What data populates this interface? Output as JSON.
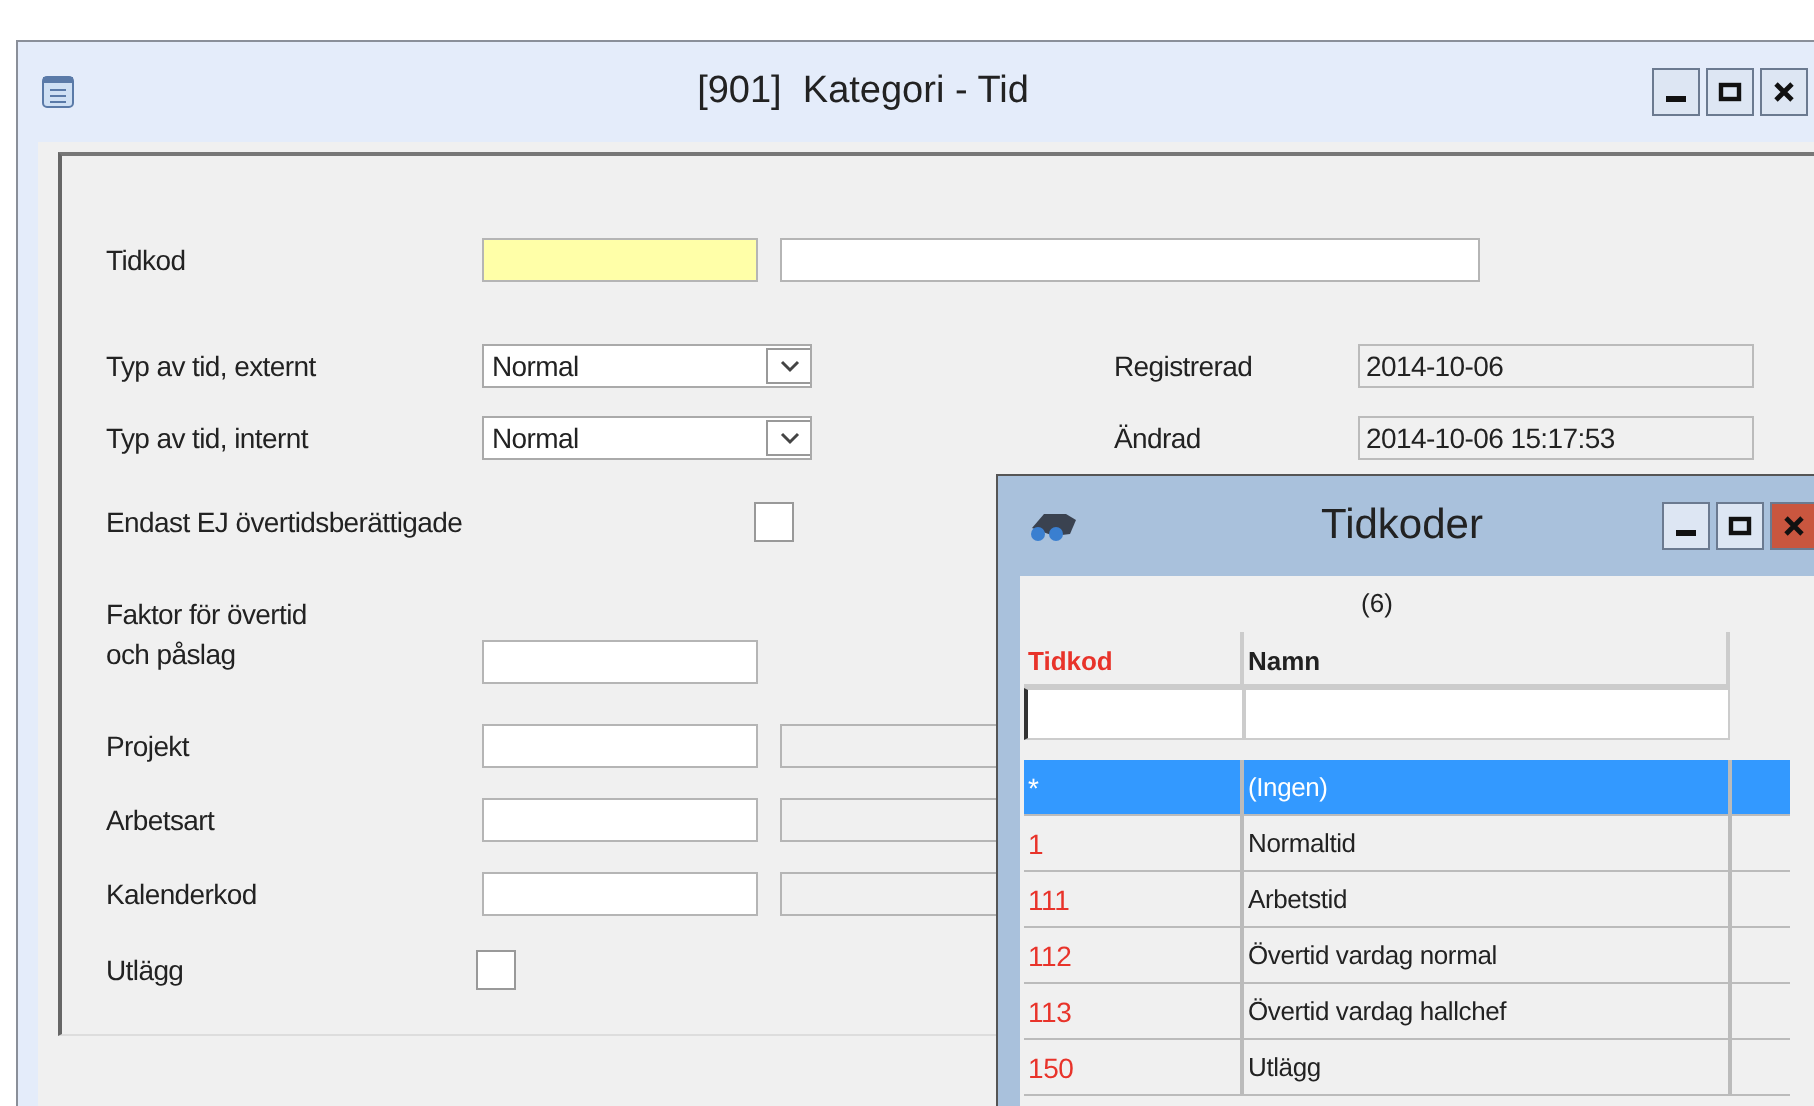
{
  "window": {
    "title": "[901]  Kategori - Tid"
  },
  "form": {
    "tidkod": {
      "label": "Tidkod"
    },
    "typ_externt": {
      "label": "Typ av tid, externt",
      "value": "Normal"
    },
    "typ_internt": {
      "label": "Typ av tid, internt",
      "value": "Normal"
    },
    "registrerad": {
      "label": "Registrerad",
      "value": "2014-10-06"
    },
    "andrad": {
      "label": "Ändrad",
      "value": "2014-10-06 15:17:53"
    },
    "endast_ej": {
      "label": "Endast EJ övertidsberättigade",
      "checked": false
    },
    "faktor": {
      "label": "Faktor för övertid\noch påslag"
    },
    "lookups": [
      {
        "label": "Projekt"
      },
      {
        "label": "Arbetsart"
      },
      {
        "label": "Kalenderkod"
      }
    ],
    "utlagg": {
      "label": "Utlägg",
      "checked": false
    }
  },
  "popup": {
    "title": "Tidkoder",
    "count": "(6)",
    "columns": [
      "Tidkod",
      "Namn"
    ],
    "rows": [
      {
        "code": "*",
        "name": "(Ingen)",
        "selected": true
      },
      {
        "code": "1",
        "name": "Normaltid",
        "selected": false
      },
      {
        "code": "111",
        "name": "Arbetstid",
        "selected": false
      },
      {
        "code": "112",
        "name": "Övertid vardag normal",
        "selected": false
      },
      {
        "code": "113",
        "name": "Övertid vardag hallchef",
        "selected": false
      },
      {
        "code": "150",
        "name": "Utlägg",
        "selected": false
      }
    ]
  }
}
